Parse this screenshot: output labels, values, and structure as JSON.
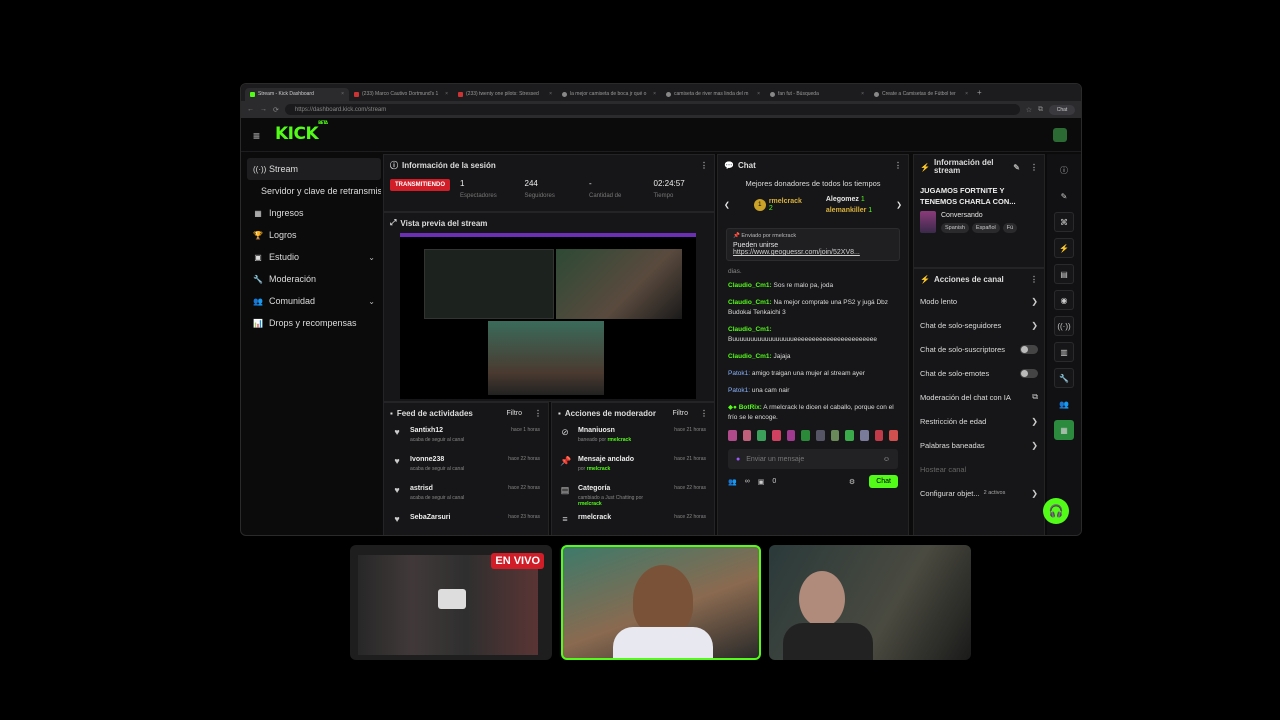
{
  "browser": {
    "tabs": [
      {
        "label": "Stream - Kick Dashboard",
        "active": true
      },
      {
        "label": "(233) Marco Cautivo Dortmund's 1",
        "active": false
      },
      {
        "label": "(233) twenty one pilots: Stressed",
        "active": false
      },
      {
        "label": "la mejor camiseta de boca jr qué o",
        "active": false
      },
      {
        "label": "camiseta de river mas linda del m",
        "active": false
      },
      {
        "label": "fan fut - Búsqueda",
        "active": false
      },
      {
        "label": "Create a Camisetas de Fútbol ter",
        "active": false
      }
    ],
    "close_glyph": "×",
    "new_tab": "+",
    "url": "https://dashboard.kick.com/stream",
    "profile_label": "Chat"
  },
  "kick": {
    "logo": "KICK",
    "logo_beta": "BETA",
    "menu_icon": "≡"
  },
  "sidebar": {
    "items": [
      {
        "label": "Stream",
        "icon": "((·))",
        "active": true
      },
      {
        "label": "Servidor y clave de retransmisión",
        "icon": "",
        "sub": true
      },
      {
        "label": "Ingresos",
        "icon": "▦"
      },
      {
        "label": "Logros",
        "icon": "🏆"
      },
      {
        "label": "Estudio",
        "icon": "▣",
        "chevron": true
      },
      {
        "label": "Moderación",
        "icon": "🔧"
      },
      {
        "label": "Comunidad",
        "icon": "👥",
        "chevron": true
      },
      {
        "label": "Drops y recompensas",
        "icon": "📊"
      }
    ]
  },
  "session": {
    "title": "Información de la sesión",
    "badge": "TRANSMITIENDO",
    "stats": [
      {
        "value": "1",
        "label": "Espectadores"
      },
      {
        "value": "244",
        "label": "Seguidores"
      },
      {
        "value": "-",
        "label": "Cantidad de"
      },
      {
        "value": "02:24:57",
        "label": "Tiempo"
      }
    ]
  },
  "preview": {
    "title": "Vista previa del stream"
  },
  "feed": {
    "title": "Feed de actividades",
    "filter": "Filtro",
    "rows": [
      {
        "name": "Santixh12",
        "sub": "acaba de seguir al canal",
        "time": "hace 1 horas",
        "icon": "♥"
      },
      {
        "name": "Ivonne238",
        "sub": "acaba de seguir al canal",
        "time": "hace 22 horas",
        "icon": "♥"
      },
      {
        "name": "astrisd",
        "sub": "acaba de seguir al canal",
        "time": "hace 22 horas",
        "icon": "♥"
      },
      {
        "name": "SebaZarsuri",
        "sub": "",
        "time": "hace 23 horas",
        "icon": "♥"
      }
    ]
  },
  "modactions": {
    "title": "Acciones de moderador",
    "filter": "Filtro",
    "rows": [
      {
        "name": "Mnaniuosn",
        "sub": "baneado por",
        "by": "rmelcrack",
        "time": "hace 21 horas",
        "icon": "⊘"
      },
      {
        "name": "Mensaje anclado",
        "sub": "por",
        "by": "rmelcrack",
        "time": "hace 21 horas",
        "icon": "📌"
      },
      {
        "name": "Categoría",
        "sub": "cambiado a Just Chatting por",
        "by": "rmelcrack",
        "time": "hace 22 horas",
        "icon": "▤"
      },
      {
        "name": "rmelcrack",
        "sub": "",
        "by": "",
        "time": "hace 22 horas",
        "icon": "≡"
      }
    ]
  },
  "chat": {
    "title": "Chat",
    "donors_title": "Mejores donadores de todos los tiempos",
    "donors": [
      {
        "rank": "1",
        "name": "rmelcrack",
        "amount": "2"
      },
      {
        "name": "Alegomez",
        "amount": "1"
      },
      {
        "name": "alemankiller",
        "amount": "1"
      }
    ],
    "pinned_by_label": "Enviado por",
    "pinned_by": "rmelcrack",
    "pinned_text": "Pueden unirse",
    "pinned_link": "https://www.geoguessr.com/join/52XV8...",
    "pinned_tail": "dias.",
    "messages": [
      {
        "user": "Claudio_Cm1:",
        "text": " Sos re malo pa, joda"
      },
      {
        "user": "Claudio_Cm1:",
        "text": " Na mejor comprate una PS2 y jugá Dbz Budokai Tenkaichi 3"
      },
      {
        "user": "Claudio_Cm1:",
        "text": " Buuuuuuuuuuuuuuuuueeeeeeeeeeeeeeeeeeeeeee"
      },
      {
        "user": "Claudio_Cm1:",
        "text": " Jajaja"
      },
      {
        "user": "Patok1:",
        "text": " amigo traigan una mujer al stream ayer",
        "alt": true
      },
      {
        "user": "Patok1:",
        "text": " una cam nair",
        "alt": true
      },
      {
        "user": "BotRix:",
        "text": " A rmelcrack le dicen el caballo, porque con el frío se le encoge.",
        "bot": true
      }
    ],
    "input_placeholder": "Enviar un mensaje",
    "infinity": "∞",
    "count": "0",
    "send": "Chat"
  },
  "info": {
    "title": "Información del stream",
    "stream_title": "JUGAMOS FORTNITE Y TENEMOS CHARLA CON...",
    "category": "Conversando",
    "tags": [
      "Spanish",
      "Español",
      "Fü"
    ]
  },
  "channel_actions": {
    "title": "Acciones de canal",
    "items": [
      {
        "label": "Modo lento",
        "kind": "arrow"
      },
      {
        "label": "Chat de solo-seguidores",
        "kind": "arrow"
      },
      {
        "label": "Chat de solo-suscriptores",
        "kind": "toggle"
      },
      {
        "label": "Chat de solo-emotes",
        "kind": "toggle"
      },
      {
        "label": "Moderación del chat con IA",
        "kind": "ext"
      },
      {
        "label": "Restricción de edad",
        "kind": "arrow"
      },
      {
        "label": "Palabras baneadas",
        "kind": "arrow"
      },
      {
        "label": "Hostear canal",
        "kind": "none",
        "dim": true
      },
      {
        "label": "Configurar objet...",
        "kind": "arrow",
        "extra": "2 activos"
      }
    ]
  },
  "overlay": {
    "live_label": "EN VIVO"
  },
  "colors": {
    "accent": "#53fc18",
    "live": "#d11d28"
  }
}
